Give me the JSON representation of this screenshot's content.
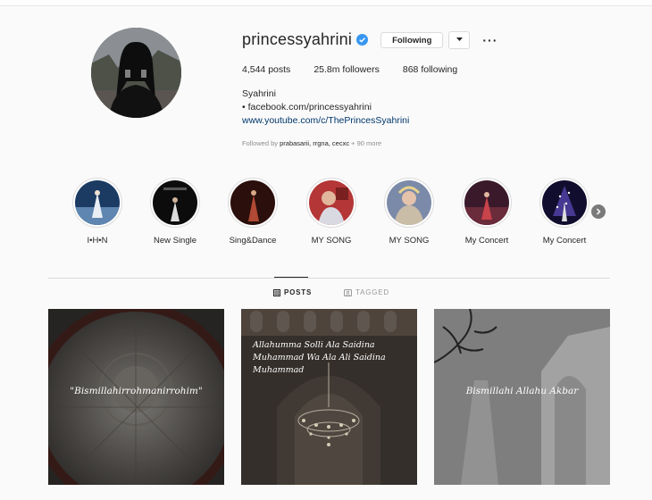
{
  "profile": {
    "username": "princessyahrini",
    "following_label": "Following",
    "posts_count": "4,544",
    "posts_label": "posts",
    "followers_count": "25.8m",
    "followers_label": "followers",
    "following_count": "868",
    "following_count_label": "following",
    "full_name": "Syahrini",
    "bio_line": "• facebook.com/princessyahrini",
    "link": "www.youtube.com/c/ThePrincesSyahrini",
    "followed_prefix": "Followed by",
    "followed_names": "prabasarii, rrgna, cecxc",
    "followed_more": "+ 90 more"
  },
  "highlights": [
    {
      "label": "I•H•N"
    },
    {
      "label": "New Single"
    },
    {
      "label": "Sing&Dance"
    },
    {
      "label": "MY SONG"
    },
    {
      "label": "MY SONG"
    },
    {
      "label": "My Concert"
    },
    {
      "label": "My Concert"
    }
  ],
  "tabs": {
    "posts": "POSTS",
    "tagged": "TAGGED"
  },
  "posts": [
    {
      "caption": "\"Bismillahirrohmanirrohim\""
    },
    {
      "caption": "Allahumma Solli Ala Saidina Muhammad Wa Ala Ali Saidina Muhammad"
    },
    {
      "caption": "Bismillahi Allahu Akbar"
    }
  ],
  "icons": {
    "verified": "verified-badge-icon",
    "caret": "chevron-down-icon",
    "more": "more-options-icon",
    "next": "chevron-right-icon",
    "grid": "grid-icon",
    "tag": "tag-icon"
  },
  "colors": {
    "verified": "#3897f0",
    "link": "#00376b",
    "background": "#fafafa"
  }
}
